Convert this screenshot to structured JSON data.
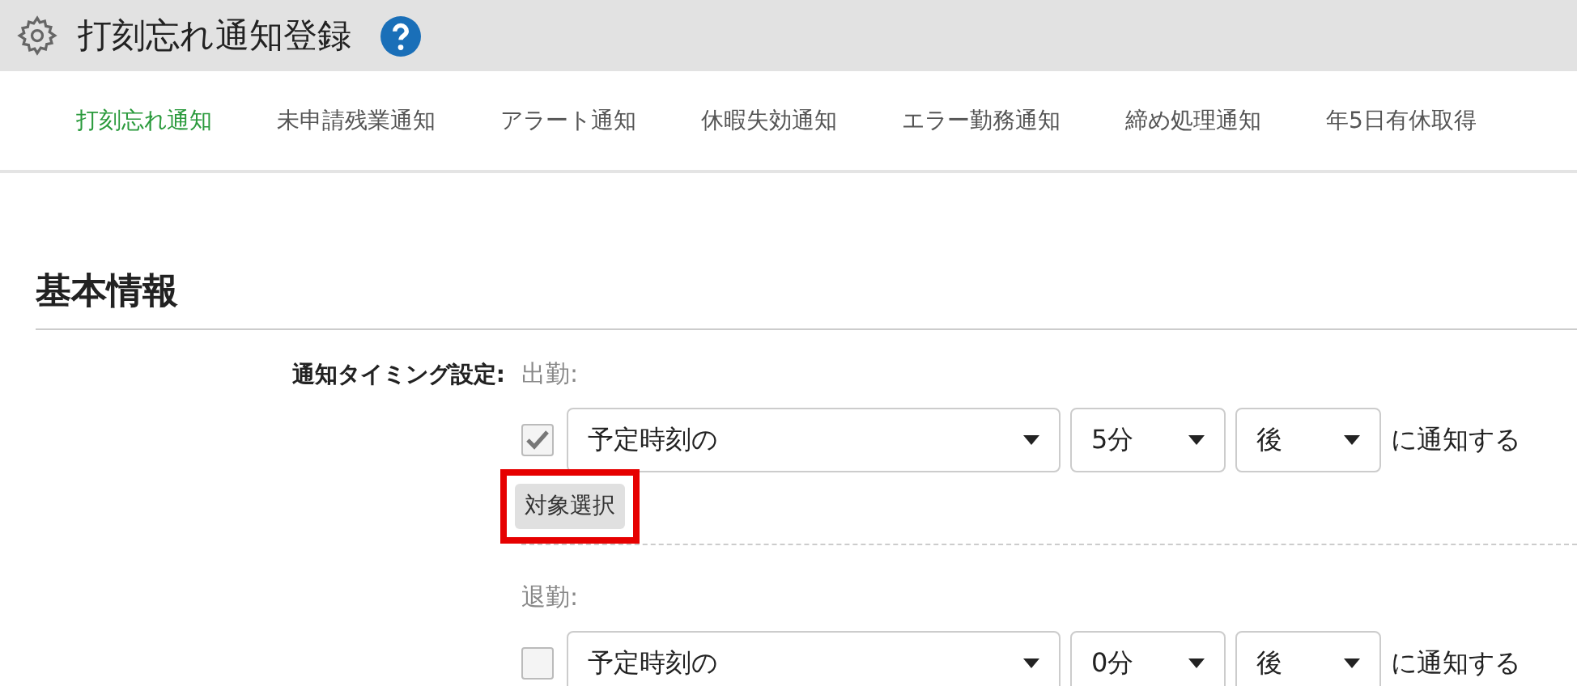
{
  "header": {
    "title": "打刻忘れ通知登録"
  },
  "tabs": [
    {
      "label": "打刻忘れ通知",
      "selected": true
    },
    {
      "label": "未申請残業通知",
      "selected": false
    },
    {
      "label": "アラート通知",
      "selected": false
    },
    {
      "label": "休暇失効通知",
      "selected": false
    },
    {
      "label": "エラー勤務通知",
      "selected": false
    },
    {
      "label": "締め処理通知",
      "selected": false
    },
    {
      "label": "年5日有休取得",
      "selected": false
    }
  ],
  "section": {
    "heading": "基本情報"
  },
  "form": {
    "label": "通知タイミング設定:",
    "groups": [
      {
        "label": "出勤:",
        "checked": true,
        "base": "予定時刻の",
        "offset": "5分",
        "direction": "後",
        "suffix": "に通知する",
        "button": "対象選択",
        "highlighted": true
      },
      {
        "label": "退勤:",
        "checked": false,
        "base": "予定時刻の",
        "offset": "0分",
        "direction": "後",
        "suffix": "に通知する"
      }
    ]
  }
}
